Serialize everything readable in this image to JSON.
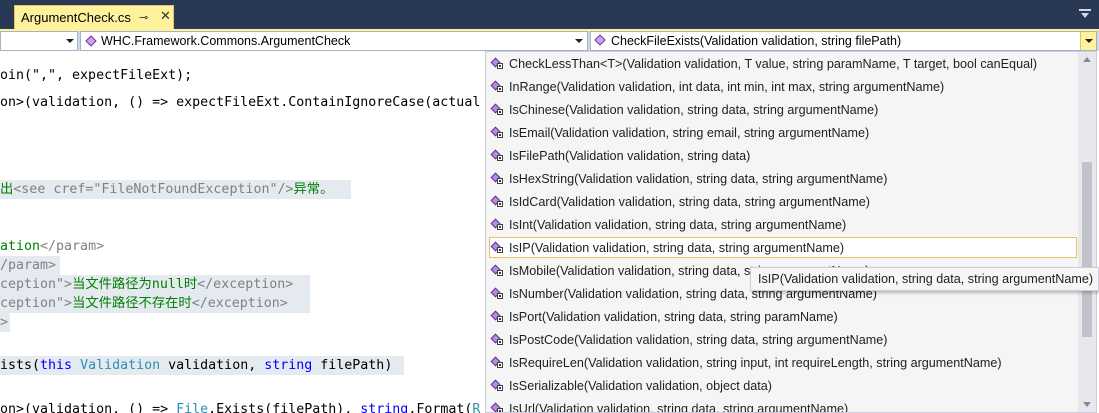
{
  "tab": {
    "title": "ArgumentCheck.cs",
    "pin_glyph": "⊸",
    "close_glyph": "✕",
    "accent": "#fff29d"
  },
  "navbar": {
    "project_combo": "",
    "class_combo": "WHC.Framework.Commons.ArgumentCheck",
    "member_combo": "CheckFileExists(Validation validation, string filePath)"
  },
  "code": {
    "lines": [
      [
        {
          "t": "oin(\",\", expectFileExt);",
          "c": ""
        }
      ],
      [
        {
          "t": "on>(validation, () => expectFileExt.ContainIgnoreCase(actual",
          "c": ""
        }
      ],
      [
        {
          "t": "",
          "c": ""
        }
      ],
      [
        {
          "t": "",
          "c": ""
        }
      ],
      [
        {
          "t": "",
          "c": ""
        }
      ],
      [
        {
          "t": "出",
          "c": "green"
        },
        {
          "t": "<see cref=\"FileNotFoundException\"/>",
          "c": "gray"
        },
        {
          "t": "异常。",
          "c": "green"
        }
      ],
      [
        {
          "t": "",
          "c": ""
        }
      ],
      [
        {
          "t": "ation",
          "c": "green"
        },
        {
          "t": "</param>",
          "c": "gray"
        }
      ],
      [
        {
          "t": "/param>",
          "c": "gray"
        }
      ],
      [
        {
          "t": "ception\">",
          "c": "gray"
        },
        {
          "t": "当文件路径为null时",
          "c": "green"
        },
        {
          "t": "</exception>",
          "c": "gray"
        }
      ],
      [
        {
          "t": "ception\">",
          "c": "gray"
        },
        {
          "t": "当文件路径不存在时",
          "c": "green"
        },
        {
          "t": "</exception>",
          "c": "gray"
        }
      ],
      [
        {
          "t": ">",
          "c": "gray"
        }
      ],
      [
        {
          "t": "",
          "c": ""
        }
      ],
      [
        {
          "t": "ists(",
          "c": ""
        },
        {
          "t": "this",
          "c": "kw"
        },
        {
          "t": " ",
          "c": ""
        },
        {
          "t": "Validation",
          "c": "type"
        },
        {
          "t": " validation, ",
          "c": ""
        },
        {
          "t": "string",
          "c": "kw"
        },
        {
          "t": " filePath)",
          "c": ""
        }
      ],
      [
        {
          "t": "",
          "c": ""
        }
      ],
      [
        {
          "t": "on>(validation, () => ",
          "c": ""
        },
        {
          "t": "File",
          "c": "type"
        },
        {
          "t": ".Exists(filePath), ",
          "c": ""
        },
        {
          "t": "string",
          "c": "kw"
        },
        {
          "t": ".Format(",
          "c": ""
        },
        {
          "t": "R",
          "c": "type"
        }
      ]
    ]
  },
  "completion": {
    "selected_index": 8,
    "items": [
      "CheckLessThan<T>(Validation validation, T value, string paramName, T target, bool canEqual)",
      "InRange(Validation validation, int data, int min, int max, string argumentName)",
      "IsChinese(Validation validation, string data, string argumentName)",
      "IsEmail(Validation validation, string email, string argumentName)",
      "IsFilePath(Validation validation, string data)",
      "IsHexString(Validation validation, string data, string argumentName)",
      "IsIdCard(Validation validation, string data, string argumentName)",
      "IsInt(Validation validation, string data, string argumentName)",
      "IsIP(Validation validation, string data, string argumentName)",
      "IsMobile(Validation validation, string data, string argumentName)",
      "IsNumber(Validation validation, string data, string argumentName)",
      "IsPort(Validation validation, string data, string paramName)",
      "IsPostCode(Validation validation, string data, string argumentName)",
      "IsRequireLen(Validation validation, string input, int requireLength, string argumentName)",
      "IsSerializable(Validation validation, object data)",
      "IsUrl(Validation validation, string data, string argumentName)"
    ],
    "tooltip": "IsIP(Validation validation, string data, string argumentName)"
  }
}
